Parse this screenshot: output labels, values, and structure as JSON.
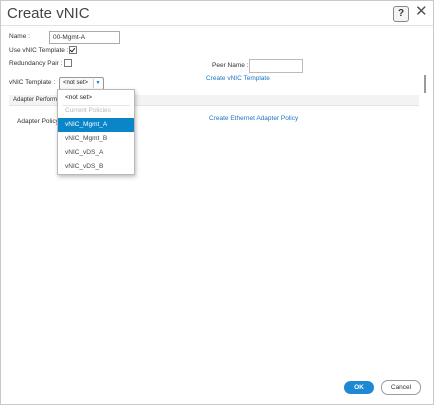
{
  "dialog": {
    "title": "Create vNIC"
  },
  "form": {
    "name_label": "Name :",
    "name_value": "00-Mgmt-A",
    "use_template_label": "Use vNIC Template :",
    "redundancy_label": "Redundancy Pair :",
    "peer_name_label": "Peer Name :",
    "template_label": "vNIC Template :",
    "template_selected": "<not set>",
    "create_template_link": "Create vNIC Template",
    "adapter_section_title": "Adapter Perform",
    "adapter_policy_label": "Adapter Policy",
    "create_adapter_policy_link": "Create Ethernet Adapter Policy"
  },
  "dropdown": {
    "options": [
      "<not set>",
      "Current Policies",
      "vNIC_Mgmt_A",
      "vNIC_Mgmt_B",
      "vNIC_vDS_A",
      "vNIC_vDS_B"
    ]
  },
  "buttons": {
    "ok": "OK",
    "cancel": "Cancel"
  },
  "colors": {
    "accent": "#0a86c8",
    "link": "#1e74c6"
  },
  "icons": {
    "help": "question-icon",
    "close": "close-icon",
    "dropdown": "chevron-down-icon"
  }
}
